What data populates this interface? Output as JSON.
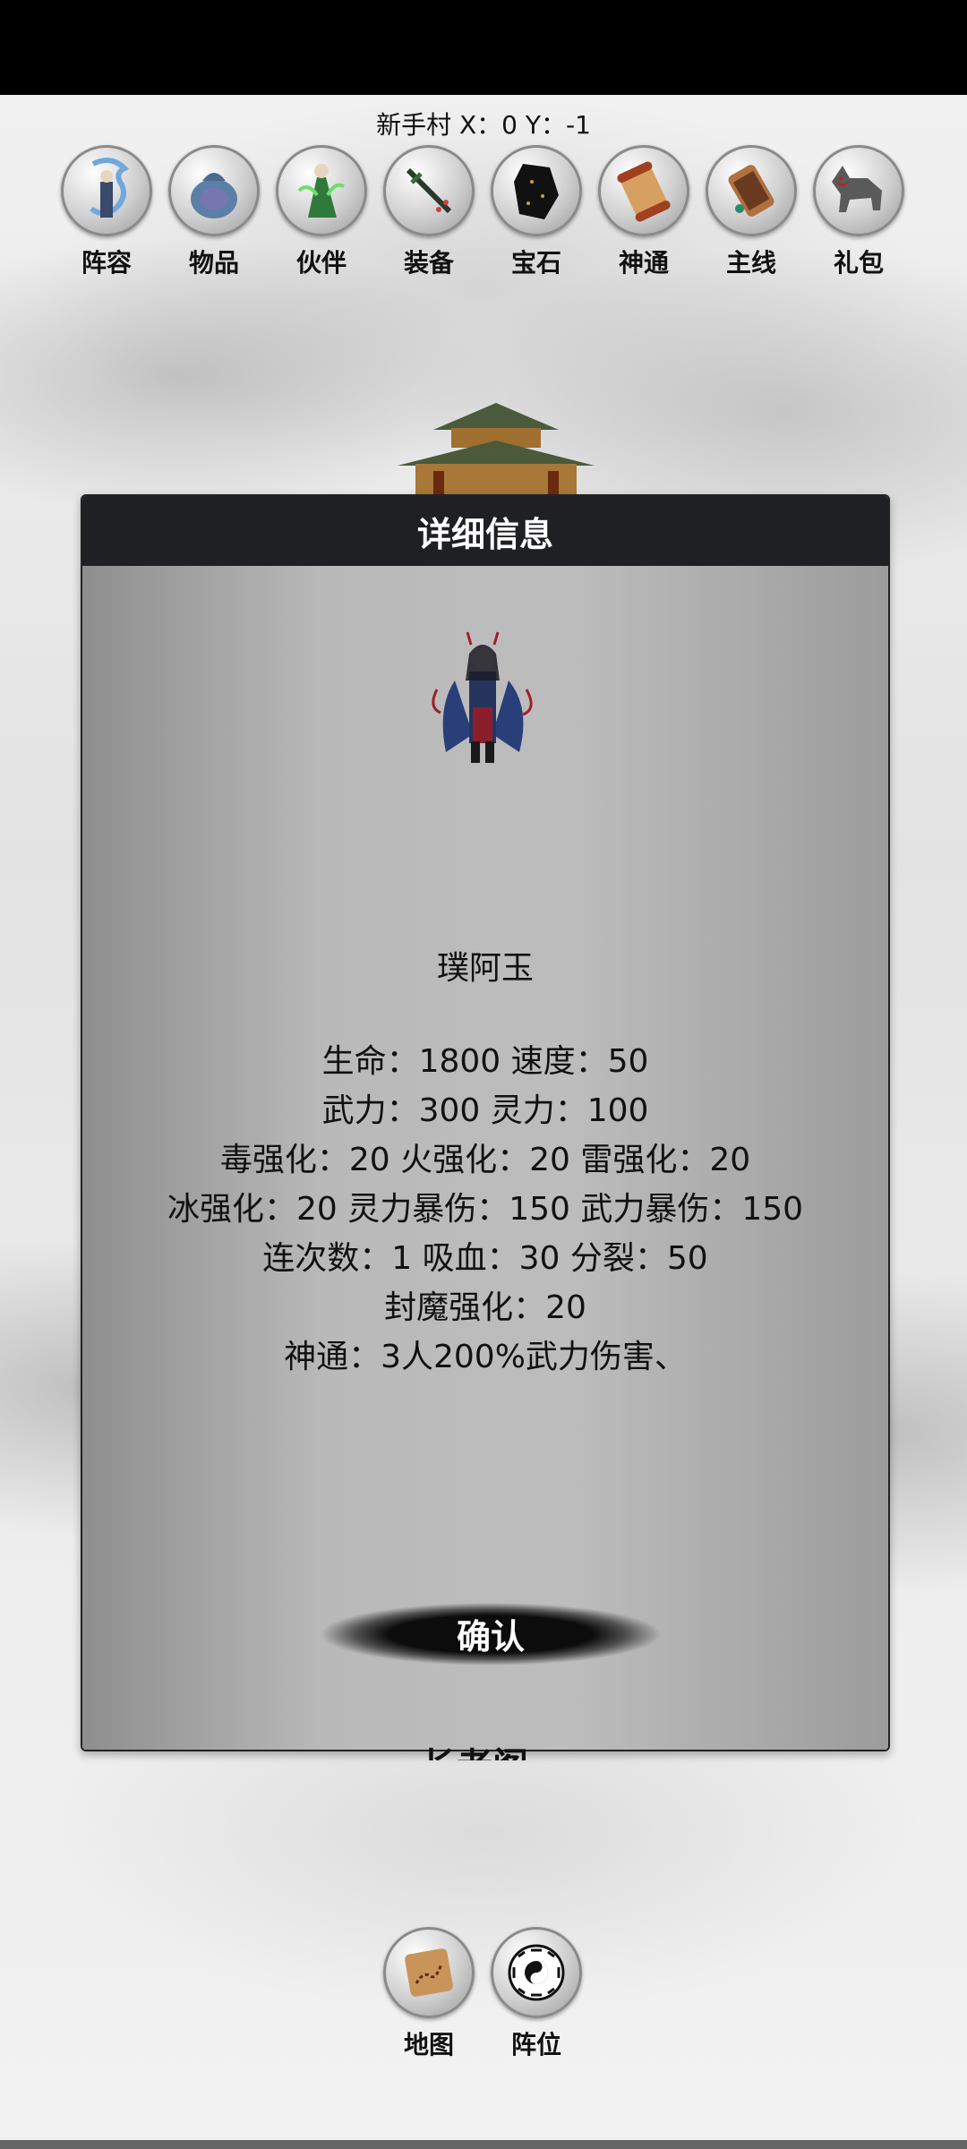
{
  "location": {
    "text": "新手村 X：0 Y：-1"
  },
  "top_menu": [
    {
      "label": "阵容",
      "icon": "dragon-warrior-icon"
    },
    {
      "label": "物品",
      "icon": "item-bag-icon"
    },
    {
      "label": "伙伴",
      "icon": "companion-icon"
    },
    {
      "label": "装备",
      "icon": "sword-icon"
    },
    {
      "label": "宝石",
      "icon": "gem-stone-icon"
    },
    {
      "label": "神通",
      "icon": "scroll-icon"
    },
    {
      "label": "主线",
      "icon": "quest-scroll-icon"
    },
    {
      "label": "礼包",
      "icon": "wolf-gift-icon"
    }
  ],
  "dialog": {
    "title": "详细信息",
    "hero_name": "璞阿玉",
    "stat_lines": [
      "生命：1800  速度：50",
      "武力：300  灵力：100",
      "毒强化：20 火强化：20 雷强化：20",
      "冰强化：20 灵力暴伤：150 武力暴伤：150",
      "连次数：1 吸血：30 分裂：50",
      "封魔强化：20",
      "神通：3人200%武力伤害、"
    ],
    "confirm_label": "确认"
  },
  "peek_text": "长老阁",
  "bottom_menu": [
    {
      "label": "地图",
      "icon": "map-icon"
    },
    {
      "label": "阵位",
      "icon": "bagua-icon"
    }
  ],
  "colors": {
    "header_bg": "#1f2023",
    "dialog_body": "#b9b9b9",
    "text": "#111111"
  }
}
